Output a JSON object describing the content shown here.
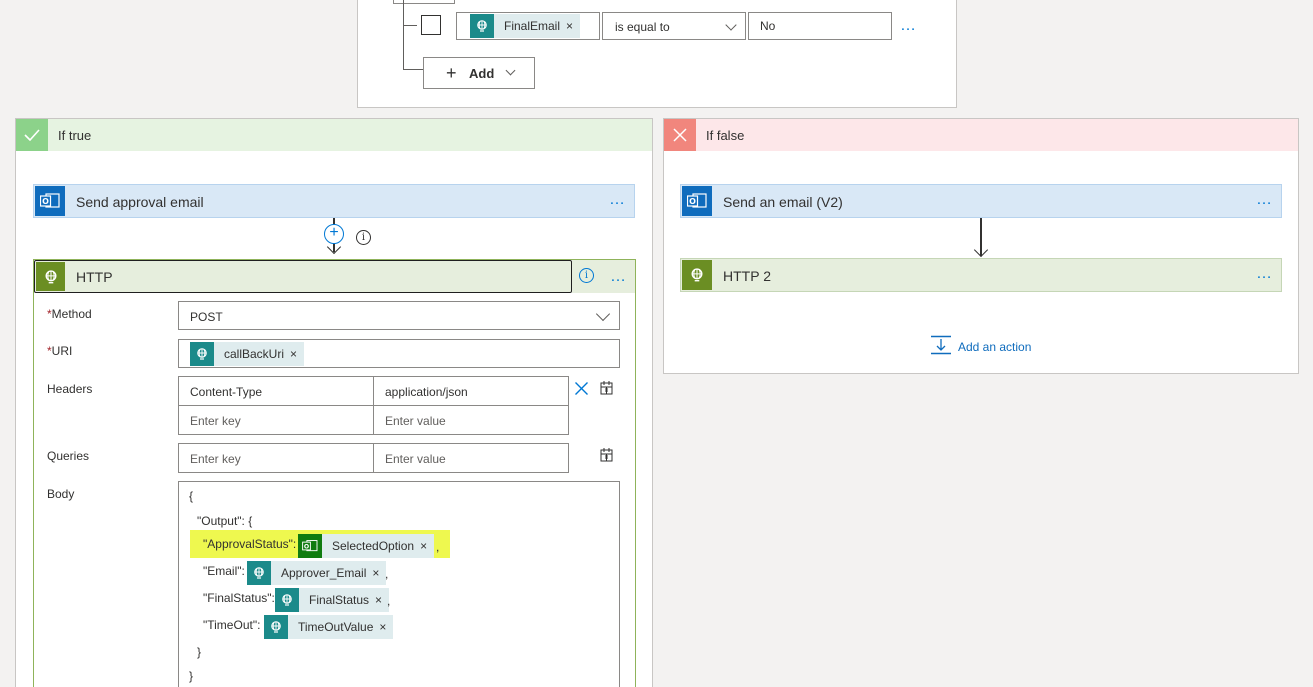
{
  "condition": {
    "token_label": "FinalEmail",
    "operator": "is equal to",
    "value": "No",
    "add_label": "Add"
  },
  "branches": {
    "true_title": "If true",
    "false_title": "If false"
  },
  "true_branch": {
    "approval_action": "Send approval email",
    "http": {
      "title": "HTTP",
      "method_label": "Method",
      "method_value": "POST",
      "uri_label": "URI",
      "uri_token": "callBackUri",
      "headers_label": "Headers",
      "header_key": "Content-Type",
      "header_value": "application/json",
      "key_placeholder": "Enter key",
      "value_placeholder": "Enter value",
      "queries_label": "Queries",
      "body_label": "Body",
      "body": {
        "open_brace": "{",
        "output_line": "\"Output\": {",
        "approval_key": "\"ApprovalStatus\":",
        "approval_token": "SelectedOption",
        "email_key": "\"Email\":",
        "email_token": "Approver_Email",
        "finalstatus_key": "\"FinalStatus\":",
        "finalstatus_token": "FinalStatus",
        "timeout_key": "\"TimeOut\":",
        "timeout_token": "TimeOutValue",
        "comma": ",",
        "close_inner": "}",
        "close_outer": "}"
      }
    }
  },
  "false_branch": {
    "email_action": "Send an email (V2)",
    "http_action": "HTTP 2",
    "add_action": "Add an action"
  },
  "icons": {
    "more": "…",
    "close": "×",
    "required": "*",
    "info": "i",
    "plus": "+"
  }
}
